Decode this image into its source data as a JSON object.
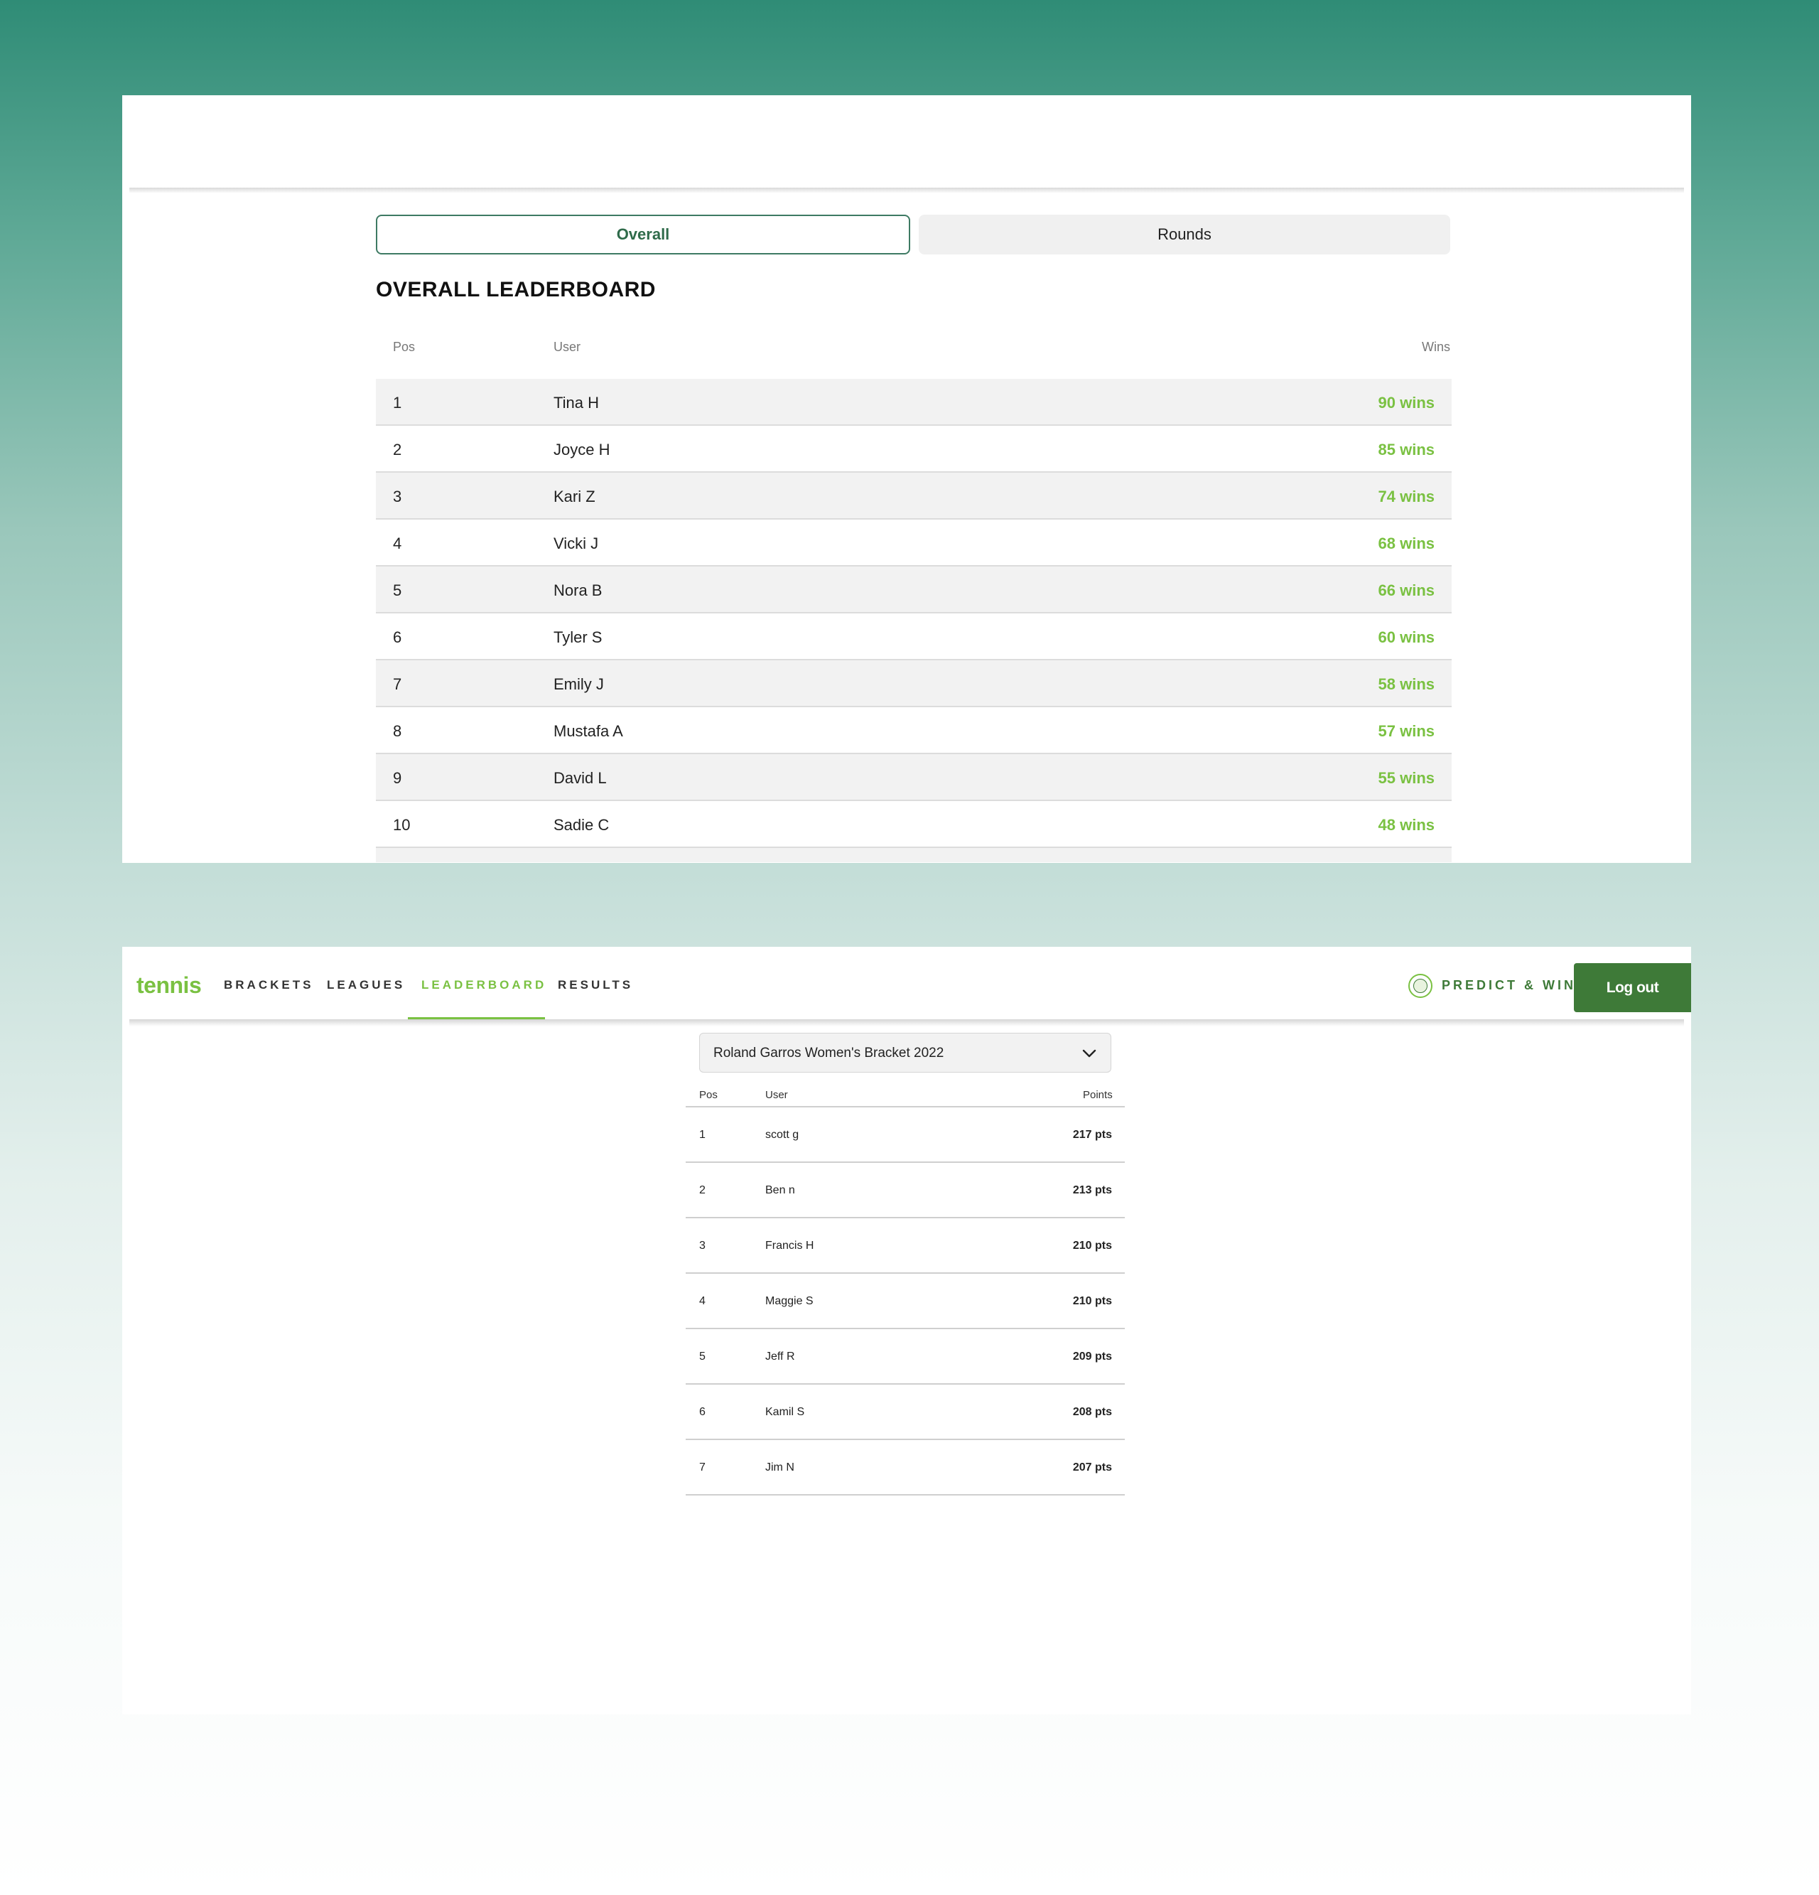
{
  "leaderboard_overall": {
    "tabs": [
      {
        "label": "Overall",
        "active": true
      },
      {
        "label": "Rounds",
        "active": false
      }
    ],
    "title": "OVERALL LEADERBOARD",
    "columns": {
      "pos": "Pos",
      "user": "User",
      "wins": "Wins"
    },
    "rows": [
      {
        "pos": "1",
        "user": "Tina H",
        "wins": "90 wins"
      },
      {
        "pos": "2",
        "user": "Joyce H",
        "wins": "85 wins"
      },
      {
        "pos": "3",
        "user": "Kari Z",
        "wins": "74 wins"
      },
      {
        "pos": "4",
        "user": "Vicki J",
        "wins": "68 wins"
      },
      {
        "pos": "5",
        "user": "Nora B",
        "wins": "66 wins"
      },
      {
        "pos": "6",
        "user": "Tyler S",
        "wins": "60 wins"
      },
      {
        "pos": "7",
        "user": "Emily J",
        "wins": "58 wins"
      },
      {
        "pos": "8",
        "user": "Mustafa A",
        "wins": "57 wins"
      },
      {
        "pos": "9",
        "user": "David L",
        "wins": "55 wins"
      },
      {
        "pos": "10",
        "user": "Sadie C",
        "wins": "48 wins"
      }
    ],
    "colors": {
      "wins": "#7ac142",
      "tab_border": "#3e7a63"
    }
  },
  "nav": {
    "logo": "tennis",
    "items": [
      {
        "label": "BRACKETS",
        "active": false
      },
      {
        "label": "LEAGUES",
        "active": false
      },
      {
        "label": "LEADERBOARD",
        "active": true
      },
      {
        "label": "RESULTS",
        "active": false
      }
    ],
    "predict_label": "PREDICT & WIN",
    "predict_icon": "predict-win-badge-icon",
    "logout_label": "Log out",
    "colors": {
      "accent": "#7ac142",
      "button": "#3e7a38"
    }
  },
  "bracket_leaderboard": {
    "selected_bracket": "Roland Garros Women's Bracket 2022",
    "dropdown_icon": "chevron-down-icon",
    "columns": {
      "pos": "Pos",
      "user": "User",
      "points": "Points"
    },
    "rows": [
      {
        "pos": "1",
        "user": "scott g",
        "points": "217 pts"
      },
      {
        "pos": "2",
        "user": "Ben n",
        "points": "213 pts"
      },
      {
        "pos": "3",
        "user": "Francis H",
        "points": "210 pts"
      },
      {
        "pos": "4",
        "user": "Maggie S",
        "points": "210 pts"
      },
      {
        "pos": "5",
        "user": "Jeff R",
        "points": "209 pts"
      },
      {
        "pos": "6",
        "user": "Kamil S",
        "points": "208 pts"
      },
      {
        "pos": "7",
        "user": "Jim N",
        "points": "207 pts"
      }
    ]
  }
}
